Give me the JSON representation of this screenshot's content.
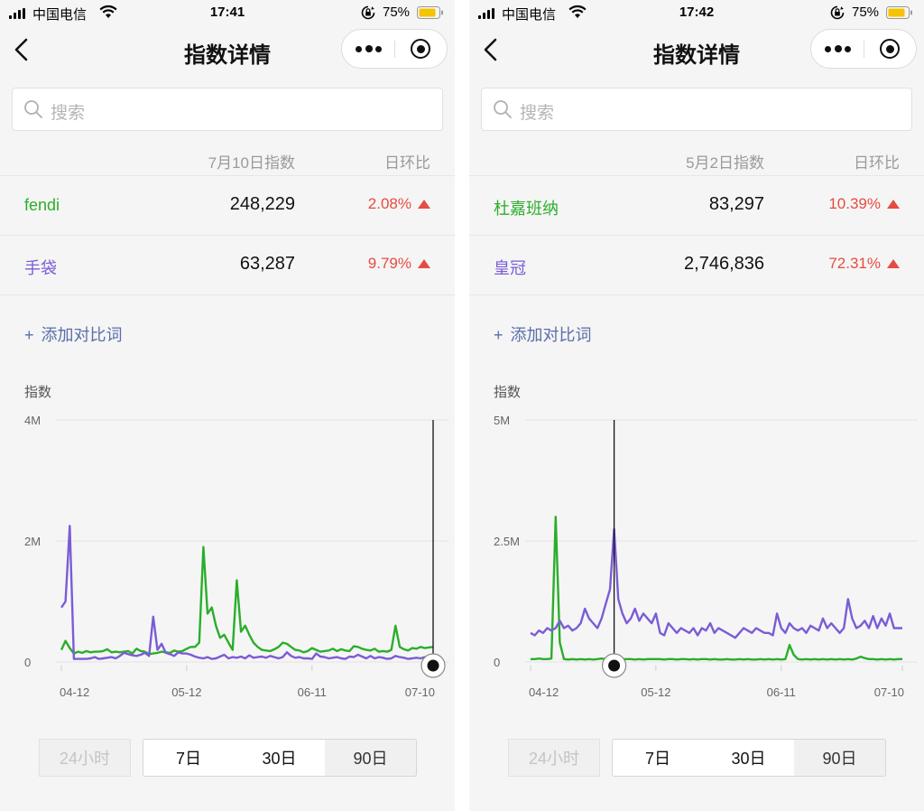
{
  "screens": [
    {
      "status": {
        "carrier": "中国电信",
        "time": "17:41",
        "battery": "75%"
      },
      "nav": {
        "title": "指数详情"
      },
      "search": {
        "placeholder": "搜索"
      },
      "table": {
        "col_index": "7月10日指数",
        "col_ratio": "日环比",
        "rows": [
          {
            "keyword": "fendi",
            "value": "248,229",
            "ratio": "2.08%",
            "color": "#2aae2a"
          },
          {
            "keyword": "手袋",
            "value": "63,287",
            "ratio": "9.79%",
            "color": "#7b5cd6"
          }
        ]
      },
      "add_label": "添加对比词",
      "ranges": [
        "24小时",
        "7日",
        "30日",
        "90日"
      ],
      "active_range": "90日",
      "chart_data": {
        "type": "line",
        "ylabel": "指数",
        "y_ticks": [
          "0",
          "2M",
          "4M"
        ],
        "ylim": [
          0,
          4000000
        ],
        "x_tick_labels": [
          "04-12",
          "05-12",
          "06-11",
          "07-10"
        ],
        "x_tick_index": [
          0,
          30,
          60,
          89
        ],
        "cursor_index": 89,
        "series": [
          {
            "name": "fendi",
            "color": "#2aae2a",
            "values": [
              200000,
              350000,
              230000,
              140000,
              170000,
              150000,
              180000,
              160000,
              170000,
              170000,
              180000,
              210000,
              160000,
              170000,
              160000,
              170000,
              180000,
              140000,
              220000,
              180000,
              170000,
              130000,
              140000,
              150000,
              170000,
              160000,
              150000,
              190000,
              170000,
              180000,
              220000,
              250000,
              250000,
              320000,
              1900000,
              800000,
              900000,
              600000,
              400000,
              450000,
              320000,
              200000,
              1350000,
              500000,
              600000,
              450000,
              320000,
              250000,
              200000,
              190000,
              180000,
              210000,
              250000,
              320000,
              300000,
              250000,
              200000,
              190000,
              160000,
              180000,
              230000,
              200000,
              170000,
              180000,
              190000,
              220000,
              180000,
              210000,
              190000,
              180000,
              260000,
              250000,
              220000,
              200000,
              190000,
              220000,
              170000,
              180000,
              170000,
              200000,
              600000,
              250000,
              210000,
              190000,
              230000,
              220000,
              250000,
              230000,
              240000,
              250000
            ]
          },
          {
            "name": "手袋",
            "color": "#7b5cd6",
            "values": [
              900000,
              1000000,
              2250000,
              50000,
              50000,
              50000,
              50000,
              60000,
              80000,
              50000,
              60000,
              70000,
              80000,
              60000,
              100000,
              150000,
              130000,
              110000,
              100000,
              120000,
              150000,
              100000,
              750000,
              200000,
              300000,
              150000,
              130000,
              100000,
              160000,
              140000,
              140000,
              120000,
              90000,
              70000,
              60000,
              80000,
              50000,
              60000,
              90000,
              120000,
              60000,
              80000,
              70000,
              90000,
              60000,
              110000,
              70000,
              80000,
              90000,
              70000,
              100000,
              80000,
              60000,
              80000,
              160000,
              100000,
              70000,
              80000,
              60000,
              60000,
              50000,
              140000,
              90000,
              80000,
              60000,
              70000,
              80000,
              60000,
              50000,
              90000,
              80000,
              120000,
              90000,
              60000,
              100000,
              60000,
              80000,
              70000,
              50000,
              60000,
              100000,
              80000,
              70000,
              50000,
              60000,
              70000,
              60000,
              80000,
              70000,
              63287
            ]
          }
        ]
      }
    },
    {
      "status": {
        "carrier": "中国电信",
        "time": "17:42",
        "battery": "75%"
      },
      "nav": {
        "title": "指数详情"
      },
      "search": {
        "placeholder": "搜索"
      },
      "table": {
        "col_index": "5月2日指数",
        "col_ratio": "日环比",
        "rows": [
          {
            "keyword": "杜嘉班纳",
            "value": "83,297",
            "ratio": "10.39%",
            "color": "#2aae2a"
          },
          {
            "keyword": "皇冠",
            "value": "2,746,836",
            "ratio": "72.31%",
            "color": "#7b5cd6"
          }
        ]
      },
      "add_label": "添加对比词",
      "ranges": [
        "24小时",
        "7日",
        "30日",
        "90日"
      ],
      "active_range": "90日",
      "chart_data": {
        "type": "line",
        "ylabel": "指数",
        "y_ticks": [
          "0",
          "2.5M",
          "5M"
        ],
        "ylim": [
          0,
          5000000
        ],
        "x_tick_labels": [
          "04-12",
          "05-12",
          "06-11",
          "07-10"
        ],
        "x_tick_index": [
          0,
          30,
          60,
          89
        ],
        "cursor_index": 20,
        "series": [
          {
            "name": "杜嘉班纳",
            "color": "#2aae2a",
            "values": [
              60000,
              60000,
              70000,
              60000,
              60000,
              70000,
              3000000,
              400000,
              60000,
              50000,
              60000,
              50000,
              60000,
              50000,
              60000,
              50000,
              60000,
              70000,
              60000,
              70000,
              83297,
              70000,
              60000,
              60000,
              60000,
              50000,
              60000,
              50000,
              60000,
              60000,
              60000,
              60000,
              50000,
              60000,
              60000,
              50000,
              60000,
              60000,
              50000,
              60000,
              50000,
              60000,
              60000,
              50000,
              60000,
              50000,
              50000,
              60000,
              50000,
              50000,
              60000,
              50000,
              60000,
              50000,
              50000,
              60000,
              50000,
              60000,
              50000,
              60000,
              50000,
              60000,
              350000,
              150000,
              60000,
              50000,
              60000,
              50000,
              60000,
              50000,
              60000,
              50000,
              60000,
              50000,
              60000,
              50000,
              60000,
              50000,
              70000,
              110000,
              80000,
              60000,
              60000,
              50000,
              60000,
              50000,
              60000,
              50000,
              60000,
              60000
            ]
          },
          {
            "name": "皇冠",
            "color": "#7b5cd6",
            "values": [
              600000,
              550000,
              650000,
              600000,
              700000,
              650000,
              700000,
              850000,
              700000,
              750000,
              650000,
              700000,
              800000,
              1100000,
              900000,
              800000,
              700000,
              900000,
              1200000,
              1500000,
              2746836,
              1300000,
              1000000,
              800000,
              900000,
              1100000,
              850000,
              1000000,
              900000,
              800000,
              1000000,
              600000,
              550000,
              800000,
              700000,
              600000,
              700000,
              650000,
              600000,
              700000,
              550000,
              700000,
              650000,
              800000,
              600000,
              700000,
              650000,
              600000,
              550000,
              500000,
              600000,
              700000,
              650000,
              600000,
              700000,
              650000,
              600000,
              600000,
              550000,
              1000000,
              700000,
              600000,
              800000,
              700000,
              650000,
              700000,
              600000,
              750000,
              700000,
              650000,
              900000,
              700000,
              800000,
              700000,
              600000,
              700000,
              1300000,
              900000,
              700000,
              750000,
              850000,
              700000,
              950000,
              700000,
              900000,
              750000,
              1000000,
              700000,
              700000,
              700000
            ]
          }
        ]
      }
    }
  ]
}
